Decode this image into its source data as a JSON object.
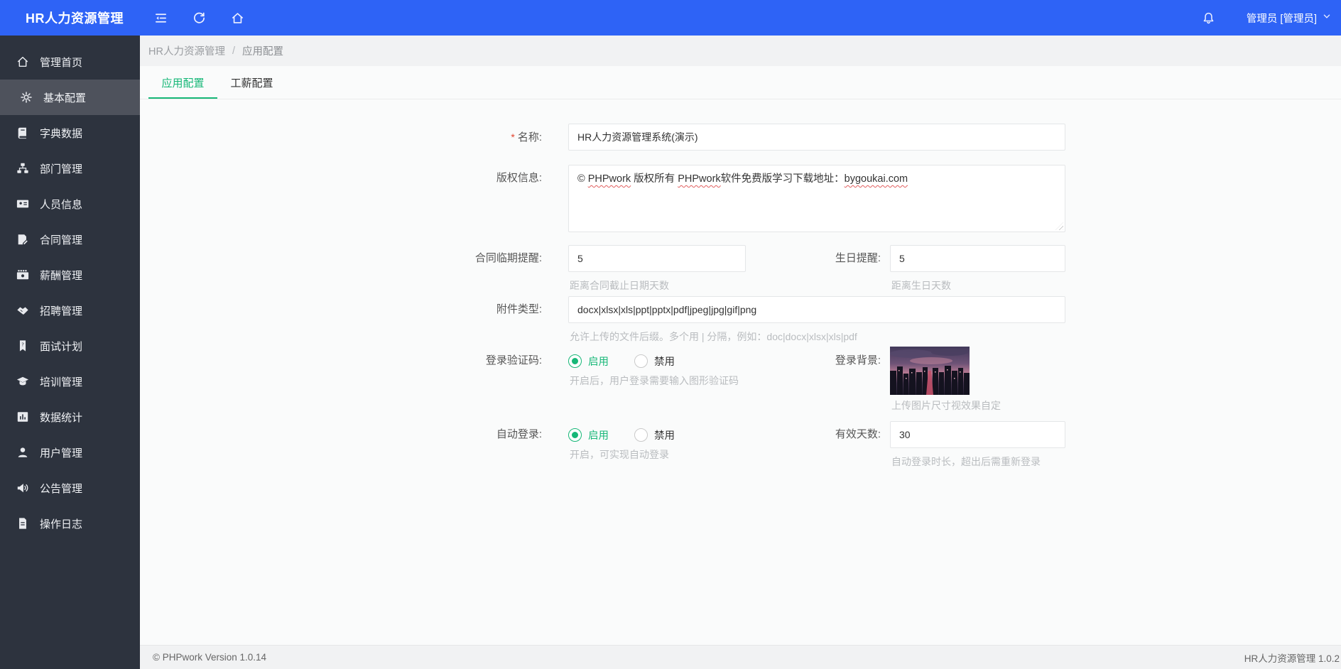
{
  "header": {
    "app_title": "HR人力资源管理",
    "user": "管理员 [管理员]",
    "icons": [
      "menu-collapse-icon",
      "refresh-icon",
      "home-icon",
      "bell-icon",
      "chevron-down-icon"
    ]
  },
  "sidebar": {
    "items": [
      {
        "label": "管理首页",
        "icon": "home-icon",
        "active": false
      },
      {
        "label": "基本配置",
        "icon": "gear-icon",
        "active": true
      },
      {
        "label": "字典数据",
        "icon": "book-icon",
        "active": false
      },
      {
        "label": "部门管理",
        "icon": "sitemap-icon",
        "active": false
      },
      {
        "label": "人员信息",
        "icon": "id-card-icon",
        "active": false
      },
      {
        "label": "合同管理",
        "icon": "contract-pen-icon",
        "active": false
      },
      {
        "label": "薪酬管理",
        "icon": "salary-money-icon",
        "active": false
      },
      {
        "label": "招聘管理",
        "icon": "handshake-icon",
        "active": false
      },
      {
        "label": "面试计划",
        "icon": "interview-tag-icon",
        "active": false
      },
      {
        "label": "培训管理",
        "icon": "graduation-cap-icon",
        "active": false
      },
      {
        "label": "数据统计",
        "icon": "bar-chart-icon",
        "active": false
      },
      {
        "label": "用户管理",
        "icon": "user-icon",
        "active": false
      },
      {
        "label": "公告管理",
        "icon": "speaker-icon",
        "active": false
      },
      {
        "label": "操作日志",
        "icon": "log-file-icon",
        "active": false
      }
    ]
  },
  "breadcrumb": {
    "root": "HR人力资源管理",
    "separator": "/",
    "current": "应用配置"
  },
  "tabs": [
    {
      "label": "应用配置",
      "active": true
    },
    {
      "label": "工薪配置",
      "active": false
    }
  ],
  "form": {
    "name": {
      "label": "名称:",
      "required_mark": "*",
      "value": "HR人力资源管理系统(演示)"
    },
    "copyright": {
      "label": "版权信息:",
      "value": "© PHPwork 版权所有 PHPwork软件免费版学习下载地址：bygoukai.com"
    },
    "contract_reminder": {
      "label": "合同临期提醒:",
      "value": "5",
      "hint": "距离合同截止日期天数"
    },
    "birthday_reminder": {
      "label": "生日提醒:",
      "value": "5",
      "hint": "距离生日天数"
    },
    "attachment_types": {
      "label": "附件类型:",
      "value": "docx|xlsx|xls|ppt|pptx|pdf|jpeg|jpg|gif|png",
      "hint": "允许上传的文件后缀。多个用 | 分隔，例如：doc|docx|xlsx|xls|pdf"
    },
    "login_captcha": {
      "label": "登录验证码:",
      "options": [
        "启用",
        "禁用"
      ],
      "selected": "启用",
      "hint": "开启后，用户登录需要输入图形验证码"
    },
    "login_background": {
      "label": "登录背景:",
      "hint": "上传图片尺寸视效果自定",
      "image": "city-night-skyline-thumbnail"
    },
    "auto_login": {
      "label": "自动登录:",
      "options": [
        "启用",
        "禁用"
      ],
      "selected": "启用",
      "hint": "开启，可实现自动登录"
    },
    "valid_days": {
      "label": "有效天数:",
      "value": "30",
      "hint": "自动登录时长，超出后需重新登录"
    }
  },
  "footer": {
    "left": "© PHPwork Version 1.0.14",
    "right": "HR人力资源管理 1.0.2"
  },
  "colors": {
    "header_bg": "#2e63f6",
    "sidebar_bg": "#2d333e",
    "sidebar_active_bg": "#4e525c",
    "accent_green": "#16b777",
    "hint_color": "#b9bcbf"
  }
}
